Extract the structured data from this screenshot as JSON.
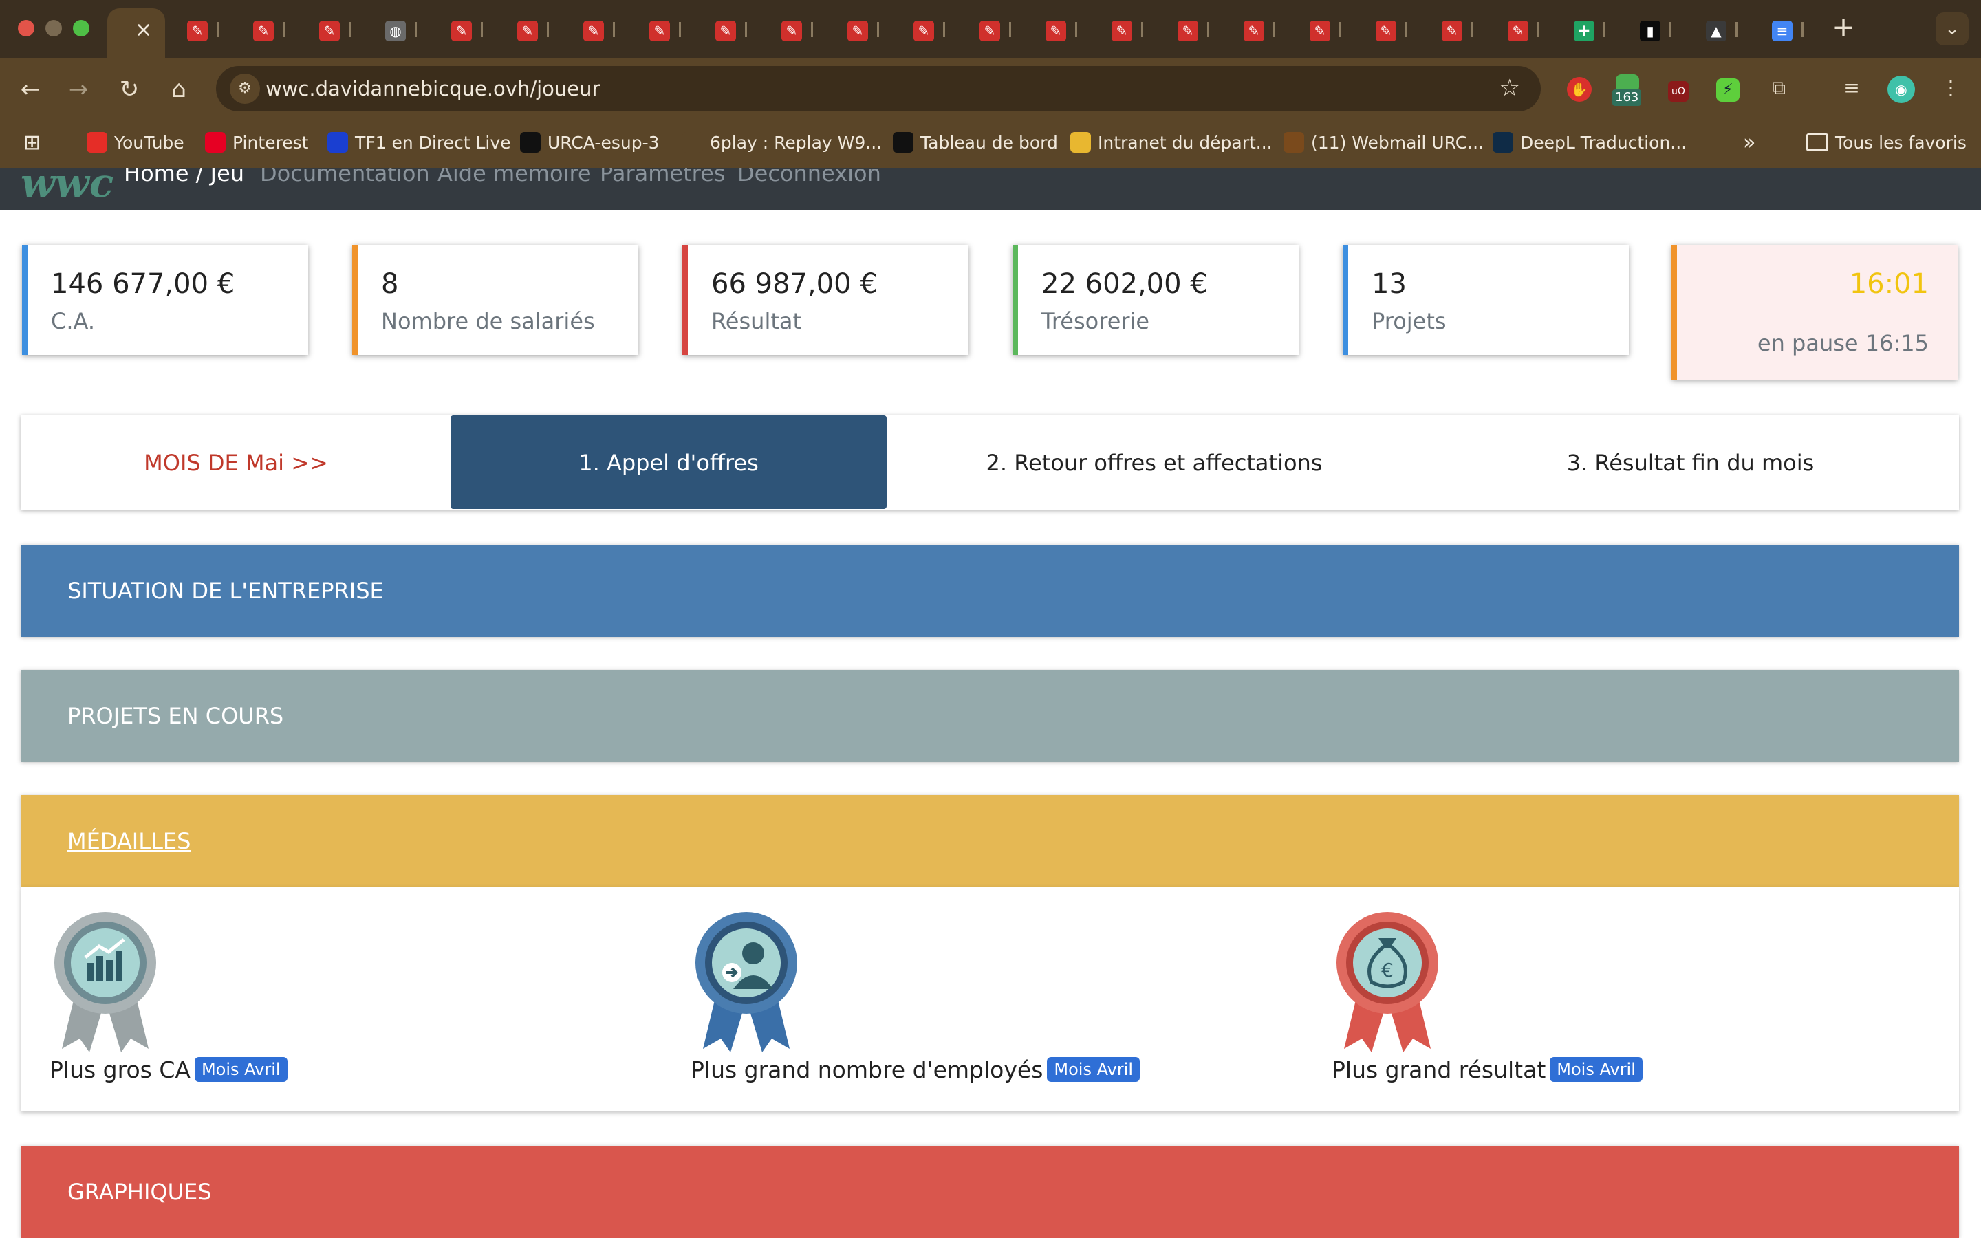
{
  "browser": {
    "url": "wwc.davidannebicque.ovh/joueur",
    "extension_badge": "163",
    "bookmarks": [
      {
        "label": "YouTube",
        "color": "#e52d27"
      },
      {
        "label": "Pinterest",
        "color": "#e60023"
      },
      {
        "label": "TF1 en Direct Live",
        "color": "#1a3fd1"
      },
      {
        "label": "URCA-esup-3",
        "color": "#111111"
      },
      {
        "label": "6play : Replay W9...",
        "color": "#5a4528"
      },
      {
        "label": "Tableau de bord",
        "color": "#111111"
      },
      {
        "label": "Intranet du départ...",
        "color": "#e8b730"
      },
      {
        "label": "(11) Webmail URC...",
        "color": "#7a4a1c"
      },
      {
        "label": "DeepL Traduction...",
        "color": "#0f2b46"
      }
    ],
    "all_bookmarks": "Tous les favoris"
  },
  "site": {
    "logo": "wwc",
    "nav": [
      "Home / Jeu",
      "Documentation",
      "Aide mémoire",
      "Paramètres",
      "Déconnexion"
    ]
  },
  "stats": [
    {
      "value": "146 677,00 €",
      "label": "C.A.",
      "color": "#3d8fe0"
    },
    {
      "value": "8",
      "label": "Nombre de salariés",
      "color": "#f0932b"
    },
    {
      "value": "66 987,00 €",
      "label": "Résultat",
      "color": "#d64541"
    },
    {
      "value": "22 602,00 €",
      "label": "Trésorerie",
      "color": "#5cb85c"
    },
    {
      "value": "13",
      "label": "Projets",
      "color": "#3d8fe0"
    }
  ],
  "clock": {
    "time": "16:01",
    "pause": "en pause 16:15"
  },
  "steps": {
    "month": "MOIS DE Mai >>",
    "items": [
      "1. Appel d'offres",
      "2. Retour offres et affectations",
      "3. Résultat fin du mois"
    ]
  },
  "sections": {
    "situation": {
      "title": "SITUATION DE L'ENTREPRISE",
      "color": "#4a7db0"
    },
    "projets": {
      "title": "PROJETS EN COURS",
      "color": "#95aaac"
    },
    "medailles": {
      "title": "MÉDAILLES",
      "color": "#e5b854"
    },
    "graphiques": {
      "title": "GRAPHIQUES",
      "color": "#d9564d"
    }
  },
  "medals": [
    {
      "label": "Plus gros CA",
      "badge": "Mois Avril",
      "icon": "chart-medal-icon",
      "ribbon": "#9aa3a5"
    },
    {
      "label": "Plus grand nombre d'employés",
      "badge": "Mois Avril",
      "icon": "employee-medal-icon",
      "ribbon": "#3a6fa8"
    },
    {
      "label": "Plus grand résultat",
      "badge": "Mois Avril",
      "icon": "money-bag-medal-icon",
      "ribbon": "#d9564d"
    }
  ]
}
